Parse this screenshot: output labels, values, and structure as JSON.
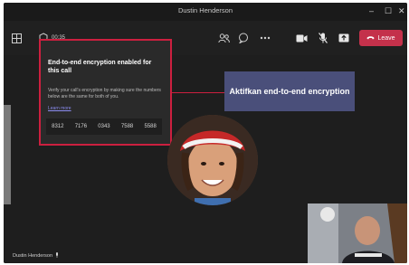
{
  "window": {
    "title": "Dustin Henderson",
    "controls": {
      "minimize": "–",
      "maximize": "☐",
      "close": "✕"
    }
  },
  "toolbar": {
    "time": "00:35",
    "leave_label": "Leave",
    "icons": [
      "grid-icon",
      "shield-icon",
      "people-icon",
      "chat-icon",
      "more-icon",
      "camera-icon",
      "mic-off-icon",
      "share-icon",
      "phone-icon"
    ]
  },
  "encryption_popup": {
    "title": "End-to-end encryption enabled for this call",
    "description": "Verify your call's encryption by making sure the numbers below are the same for both of you.",
    "learn_more": "Learn more",
    "codes": [
      "8312",
      "7176",
      "0343",
      "7588",
      "5588"
    ]
  },
  "callout": {
    "text": "Aktifkan end-to-end encryption"
  },
  "participant": {
    "name": "Dustin Henderson"
  },
  "colors": {
    "highlight": "#cc1f3f",
    "callout_bg": "#4a4f7a",
    "leave_button": "#c4314b"
  }
}
